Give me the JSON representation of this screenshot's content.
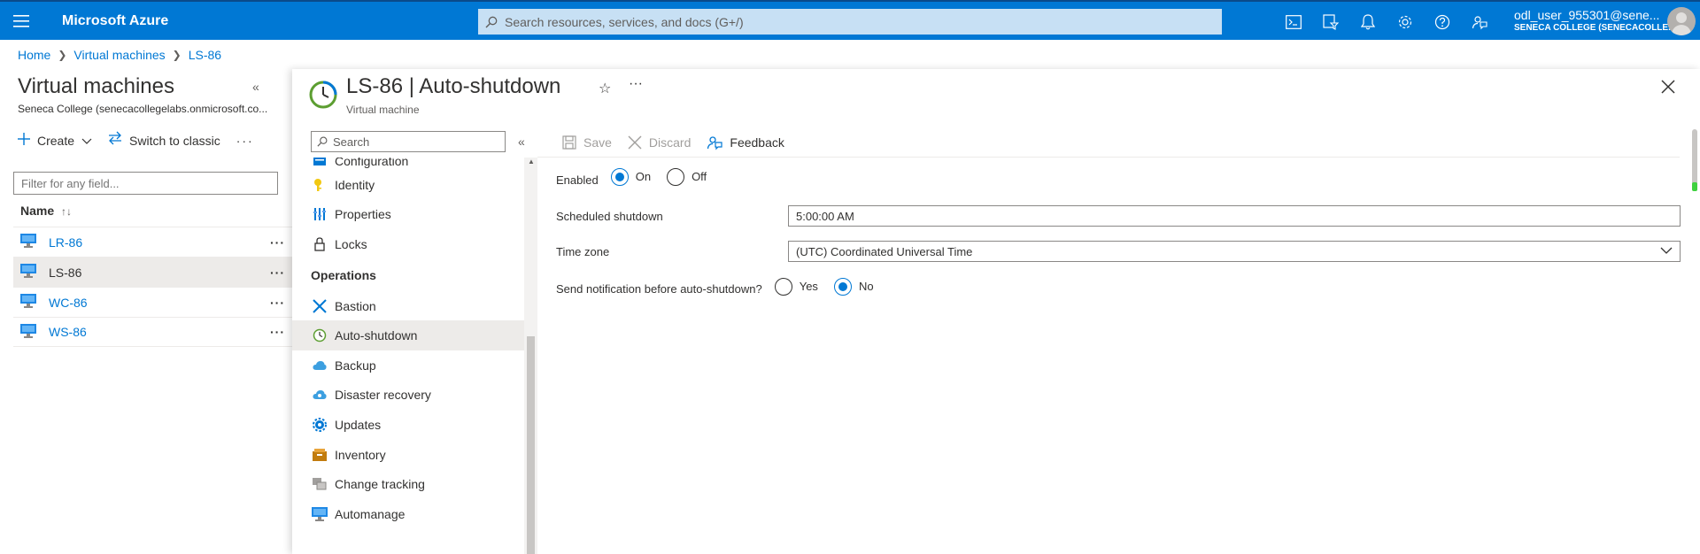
{
  "topbar": {
    "brand": "Microsoft Azure",
    "search_placeholder": "Search resources, services, and docs (G+/)",
    "user_name": "odl_user_955301@sene...",
    "user_org": "SENECA COLLEGE (SENECACOLLE..."
  },
  "breadcrumb": [
    "Home",
    "Virtual machines",
    "LS-86"
  ],
  "left_pane": {
    "title": "Virtual machines",
    "subtitle": "Seneca College (senecacollegelabs.onmicrosoft.co...",
    "create_label": "Create",
    "switch_label": "Switch to classic",
    "filter_placeholder": "Filter for any field...",
    "column_name": "Name",
    "vms": [
      {
        "name": "LR-86",
        "selected": false
      },
      {
        "name": "LS-86",
        "selected": true
      },
      {
        "name": "WC-86",
        "selected": false
      },
      {
        "name": "WS-86",
        "selected": false
      }
    ]
  },
  "blade": {
    "title": "LS-86 | Auto-shutdown",
    "subtitle": "Virtual machine",
    "menu_search_placeholder": "Search",
    "menu_items": [
      {
        "label": "Configuration",
        "icon": "configuration-icon"
      },
      {
        "label": "Identity",
        "icon": "identity-icon"
      },
      {
        "label": "Properties",
        "icon": "properties-icon"
      },
      {
        "label": "Locks",
        "icon": "lock-icon"
      }
    ],
    "section_operations": "Operations",
    "operations_items": [
      {
        "label": "Bastion",
        "icon": "bastion-icon"
      },
      {
        "label": "Auto-shutdown",
        "icon": "clock-icon",
        "selected": true
      },
      {
        "label": "Backup",
        "icon": "backup-icon"
      },
      {
        "label": "Disaster recovery",
        "icon": "disaster-recovery-icon"
      },
      {
        "label": "Updates",
        "icon": "updates-icon"
      },
      {
        "label": "Inventory",
        "icon": "inventory-icon"
      },
      {
        "label": "Change tracking",
        "icon": "change-tracking-icon"
      },
      {
        "label": "Automanage",
        "icon": "automanage-icon"
      }
    ],
    "toolbar": {
      "save_label": "Save",
      "discard_label": "Discard",
      "feedback_label": "Feedback"
    },
    "form": {
      "enabled_label": "Enabled",
      "enabled_on": "On",
      "enabled_off": "Off",
      "enabled_value": "On",
      "scheduled_label": "Scheduled shutdown",
      "scheduled_value": "5:00:00 AM",
      "timezone_label": "Time zone",
      "timezone_value": "(UTC) Coordinated Universal Time",
      "notify_label": "Send notification before auto-shutdown?",
      "notify_yes": "Yes",
      "notify_no": "No",
      "notify_value": "No"
    }
  },
  "colors": {
    "accent": "#0078d4",
    "topbar": "#0078d4"
  }
}
